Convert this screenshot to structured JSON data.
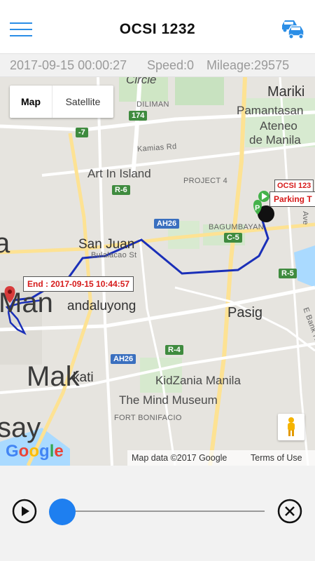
{
  "header": {
    "title": "OCSI 1232",
    "menu_icon": "hamburger-menu-icon",
    "vehicles_icon": "cars-icon",
    "accent_color": "#2b8ee6"
  },
  "info": {
    "datetime": "2017-09-15 00:00:27",
    "speed": "Speed:0",
    "mileage": "Mileage:29575"
  },
  "map": {
    "type_control": {
      "map_label": "Map",
      "satellite_label": "Satellite",
      "selected": "Map"
    },
    "labels": {
      "circle": "Circle",
      "diliman": "DILIMAN",
      "marikina": "Mariki",
      "pamantasan": "Pamantasan",
      "ateneo": "Ateneo",
      "de_manila": "de Manila",
      "kamias_rd": "Kamias Rd",
      "art_in_island": "Art In Island",
      "project4": "PROJECT 4",
      "bagumbayan": "BAGUMBAYAN",
      "san_juan": "San Juan",
      "bulalacao": "Bulalacao St",
      "manila_a": "a",
      "man": "Man",
      "mandaluyong": "andaluyong",
      "pasig": "Pasig",
      "makati": "Mak",
      "kati": "kati",
      "kidzania": "KidZania Manila",
      "mind_museum": "The Mind Museum",
      "fort_bonifacio": "FORT BONIFACIO",
      "pasay": "say",
      "e_bank": "E Bank R",
      "ave": "Ave"
    },
    "road_shields": [
      "174",
      "C-5",
      "R-6",
      "AH26",
      "R-5",
      "R-4",
      "AH26",
      "-7"
    ],
    "markers": {
      "end_label": "End : 2017-09-15 10:44:57",
      "vehicle_label": "OCSI 123",
      "parking_label": "Parking T"
    },
    "route_color": "#1a2fb8",
    "attribution": "Map data ©2017 Google",
    "terms": "Terms of Use",
    "google_logo": "Google"
  },
  "player": {
    "play_icon": "play-icon",
    "close_icon": "close-icon",
    "progress": 0,
    "thumb_color": "#1e7ff0"
  }
}
